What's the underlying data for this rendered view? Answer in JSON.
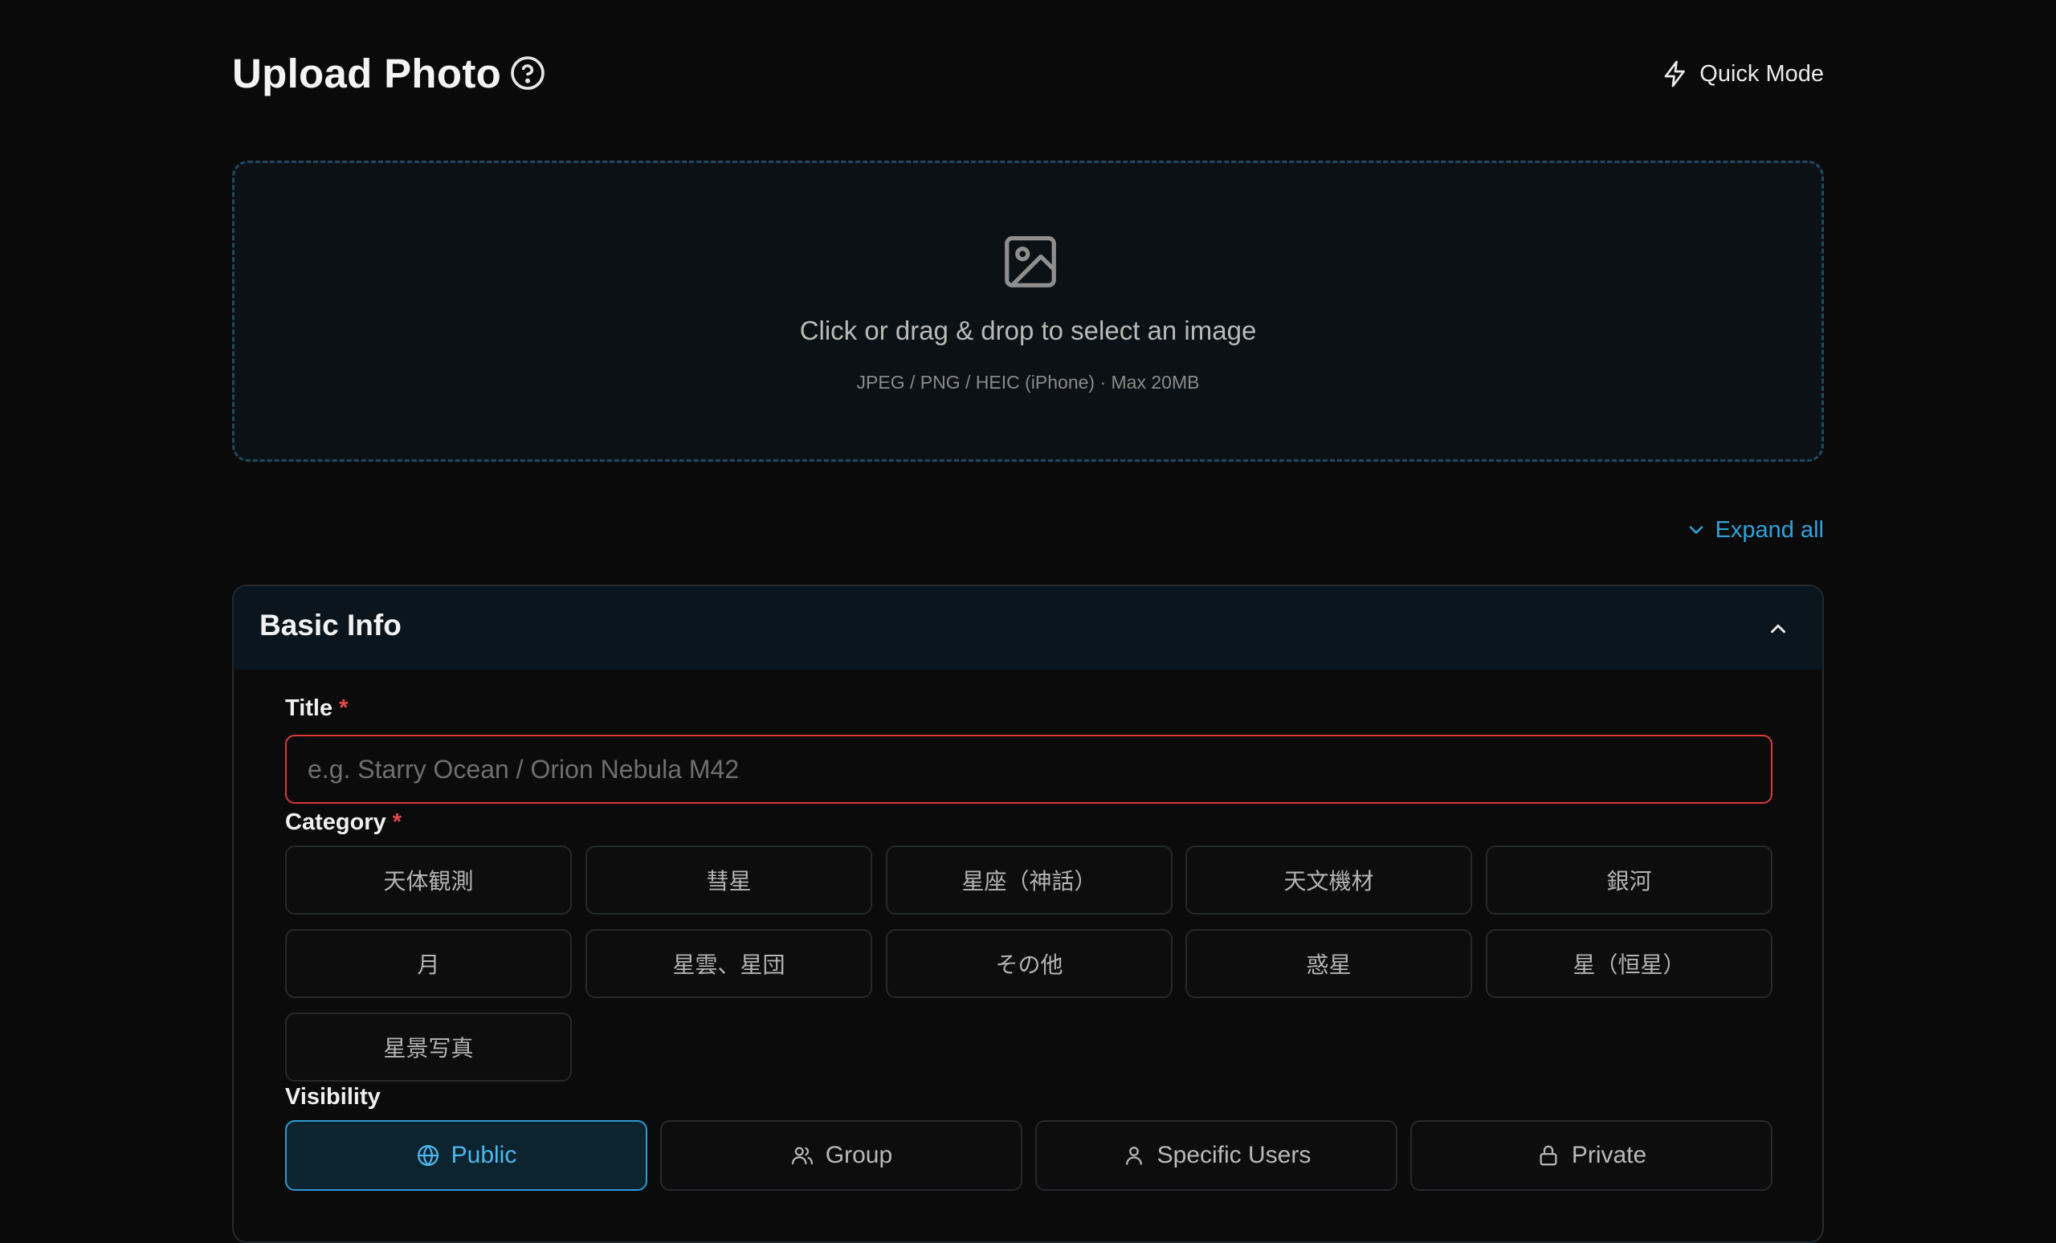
{
  "header": {
    "title": "Upload Photo",
    "help_icon": "question-circle-icon",
    "quick_mode_label": "Quick Mode",
    "quick_mode_icon": "lightning-icon"
  },
  "dropzone": {
    "icon": "image-icon",
    "text": "Click or drag & drop to select an image",
    "subtext": "JPEG / PNG / HEIC (iPhone) · Max 20MB"
  },
  "expand_all_label": "Expand all",
  "section": {
    "title": "Basic Info",
    "fields": {
      "title_label": "Title",
      "title_placeholder": "e.g. Starry Ocean / Orion Nebula M42",
      "title_value": "",
      "category_label": "Category",
      "required_mark": "*",
      "visibility_label": "Visibility"
    },
    "categories": [
      "天体観測",
      "彗星",
      "星座（神話）",
      "天文機材",
      "銀河",
      "月",
      "星雲、星団",
      "その他",
      "惑星",
      "星（恒星）",
      "星景写真"
    ],
    "visibility": [
      {
        "label": "Public",
        "icon": "globe-icon",
        "selected": true
      },
      {
        "label": "Group",
        "icon": "users-icon",
        "selected": false
      },
      {
        "label": "Specific Users",
        "icon": "user-icon",
        "selected": false
      },
      {
        "label": "Private",
        "icon": "lock-icon",
        "selected": false
      }
    ]
  },
  "colors": {
    "background": "#0a0a0a",
    "accent": "#2ea3dc",
    "required": "#e5484d",
    "error_border": "#d9383d"
  }
}
